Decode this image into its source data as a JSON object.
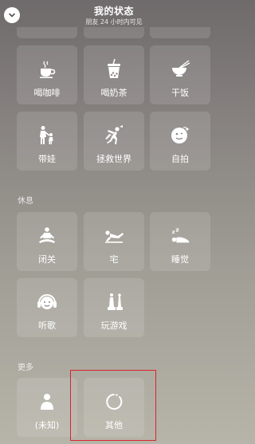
{
  "header": {
    "title": "我的状态",
    "subtitle": "朋友 24 小时内可见"
  },
  "food": [
    {
      "label": "喝咖啡",
      "icon": "coffee-cup-icon"
    },
    {
      "label": "喝奶茶",
      "icon": "bubble-tea-icon"
    },
    {
      "label": "干饭",
      "icon": "rice-bowl-icon"
    }
  ],
  "activity": [
    {
      "label": "带娃",
      "icon": "parent-with-child-icon"
    },
    {
      "label": "拯救世界",
      "icon": "flying-hero-icon"
    },
    {
      "label": "自拍",
      "icon": "selfie-face-icon"
    }
  ],
  "rest": {
    "section_label": "休息",
    "items": [
      {
        "label": "闭关",
        "icon": "meditation-icon"
      },
      {
        "label": "宅",
        "icon": "lying-down-icon"
      },
      {
        "label": "睡觉",
        "icon": "sleeping-zzz-icon"
      },
      {
        "label": "听歌",
        "icon": "headphones-icon"
      },
      {
        "label": "玩游戏",
        "icon": "chess-pieces-icon"
      }
    ]
  },
  "more": {
    "section_label": "更多",
    "items": [
      {
        "label": "(未知)",
        "icon": "unknown-person-icon"
      },
      {
        "label": "其他",
        "icon": "refresh-circle-icon"
      }
    ]
  },
  "colors": {
    "highlight": "#d8262b"
  }
}
